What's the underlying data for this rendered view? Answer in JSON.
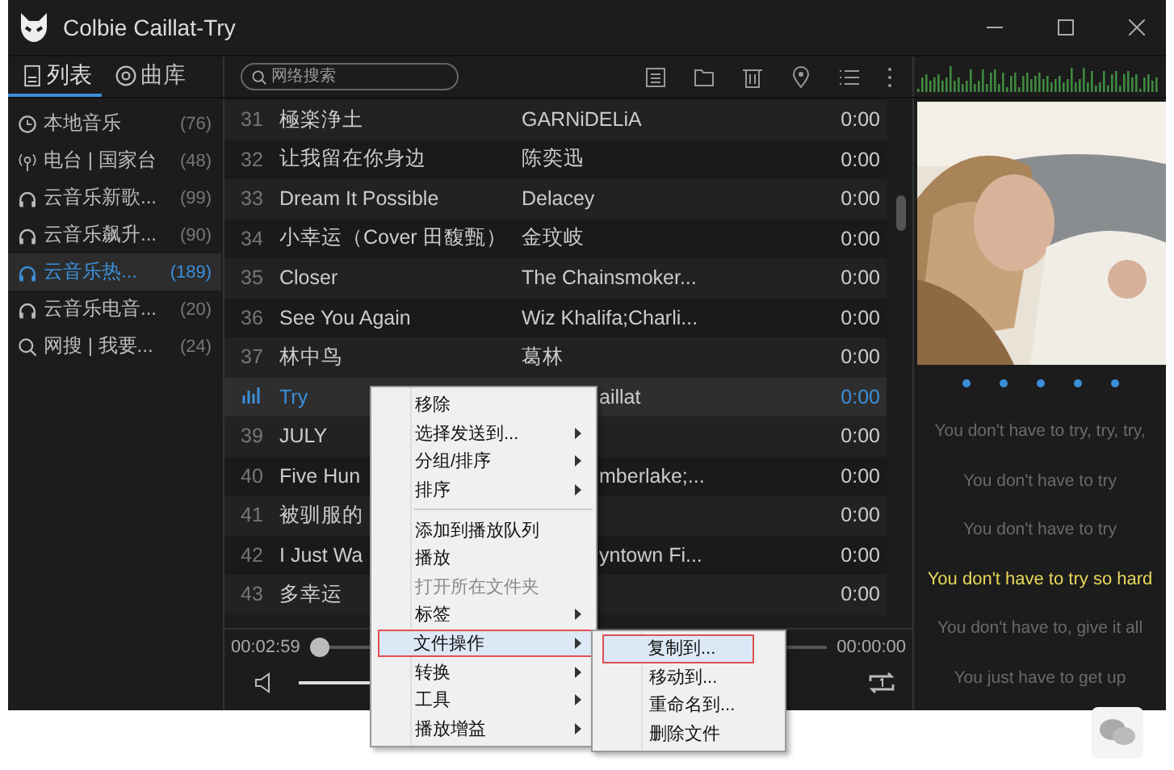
{
  "window": {
    "title": "Colbie Caillat-Try"
  },
  "tabs": [
    {
      "label": "列表",
      "selected": true
    },
    {
      "label": "曲库",
      "selected": false
    }
  ],
  "search": {
    "placeholder": "网络搜索"
  },
  "sidebar": {
    "items": [
      {
        "kind": "local",
        "label": "本地音乐",
        "count": "(76)",
        "selected": false
      },
      {
        "kind": "radio",
        "label": "电台 | 国家台",
        "count": "(48)",
        "selected": false
      },
      {
        "kind": "cloud",
        "label": "云音乐新歌...",
        "count": "(99)",
        "selected": false
      },
      {
        "kind": "cloud",
        "label": "云音乐飙升...",
        "count": "(90)",
        "selected": false
      },
      {
        "kind": "cloud",
        "label": "云音乐热...",
        "count": "(189)",
        "selected": true
      },
      {
        "kind": "cloud",
        "label": "云音乐电音...",
        "count": "(20)",
        "selected": false
      },
      {
        "kind": "search",
        "label": "网搜 | 我要...",
        "count": "(24)",
        "selected": false
      }
    ]
  },
  "tracks": [
    {
      "number": "31",
      "title": "極楽浄土",
      "artist": "GARNiDELiA",
      "duration": "0:00",
      "playing": false,
      "under_menu": false
    },
    {
      "number": "32",
      "title": "让我留在你身边",
      "artist": "陈奕迅",
      "duration": "0:00",
      "playing": false,
      "under_menu": false
    },
    {
      "number": "33",
      "title": "Dream It Possible",
      "artist": "Delacey",
      "duration": "0:00",
      "playing": false,
      "under_menu": false
    },
    {
      "number": "34",
      "title": "小幸运（Cover 田馥甄）",
      "artist": "金玟岐",
      "duration": "0:00",
      "playing": false,
      "under_menu": false
    },
    {
      "number": "35",
      "title": "Closer",
      "artist": "The Chainsmoker...",
      "duration": "0:00",
      "playing": false,
      "under_menu": false
    },
    {
      "number": "36",
      "title": "See You Again",
      "artist": "Wiz Khalifa;Charli...",
      "duration": "0:00",
      "playing": false,
      "under_menu": false
    },
    {
      "number": "37",
      "title": "林中鸟",
      "artist": "葛林",
      "duration": "0:00",
      "playing": false,
      "under_menu": false
    },
    {
      "title": "Try",
      "artist": "aillat",
      "duration": "0:00",
      "playing": true,
      "under_menu": true
    },
    {
      "number": "39",
      "title": "JULY",
      "duration": "0:00",
      "playing": false
    },
    {
      "number": "40",
      "title": "Five Hun",
      "artist": "mberlake;...",
      "duration": "0:00",
      "playing": false,
      "under_menu": true
    },
    {
      "number": "41",
      "title": "被驯服的",
      "duration": "0:00",
      "playing": false
    },
    {
      "number": "42",
      "title": "I Just Wa",
      "artist": "yntown Fi...",
      "duration": "0:00",
      "playing": false,
      "under_menu": true
    },
    {
      "number": "43",
      "title": "多幸运",
      "duration": "0:00",
      "playing": false
    }
  ],
  "player": {
    "elapsed": "00:02:59",
    "total": "00:00:00",
    "progress": {
      "level": 0.02
    },
    "volume": {
      "level": 0.55
    }
  },
  "lyrics": [
    {
      "text": "You don't have to try, try, try,",
      "current": false
    },
    {
      "text": "You don't have to try",
      "current": false
    },
    {
      "text": "You don't have to try",
      "current": false
    },
    {
      "text": "You don't have to try so hard",
      "current": true
    },
    {
      "text": "You don't have to, give it all",
      "current": false
    },
    {
      "text": "You just have to get up",
      "current": false
    }
  ],
  "context_menu": {
    "items": [
      {
        "label": "移除",
        "submenu": false,
        "disabled": false,
        "selected": false
      },
      {
        "label": "选择发送到...",
        "submenu": true,
        "disabled": false,
        "selected": false
      },
      {
        "label": "分组/排序",
        "submenu": true,
        "disabled": false,
        "selected": false
      },
      {
        "label": "排序",
        "submenu": true,
        "disabled": false,
        "selected": false
      },
      {
        "kind": "separator"
      },
      {
        "label": "添加到播放队列",
        "submenu": false,
        "disabled": false,
        "selected": false
      },
      {
        "label": "播放",
        "submenu": false,
        "disabled": false,
        "selected": false
      },
      {
        "label": "打开所在文件夹",
        "submenu": false,
        "disabled": true,
        "selected": false
      },
      {
        "label": "标签",
        "submenu": true,
        "disabled": false,
        "selected": false
      },
      {
        "label": "文件操作",
        "submenu": true,
        "disabled": false,
        "selected": true
      },
      {
        "label": "转换",
        "submenu": true,
        "disabled": false,
        "selected": false
      },
      {
        "label": "工具",
        "submenu": true,
        "disabled": false,
        "selected": false
      },
      {
        "label": "播放增益",
        "submenu": true,
        "disabled": false,
        "selected": false
      }
    ]
  },
  "submenu": {
    "items": [
      {
        "label": "复制到...",
        "selected": true
      },
      {
        "label": "移动到...",
        "selected": false
      },
      {
        "label": "重命名到...",
        "selected": false
      },
      {
        "label": "删除文件",
        "selected": false
      }
    ]
  }
}
